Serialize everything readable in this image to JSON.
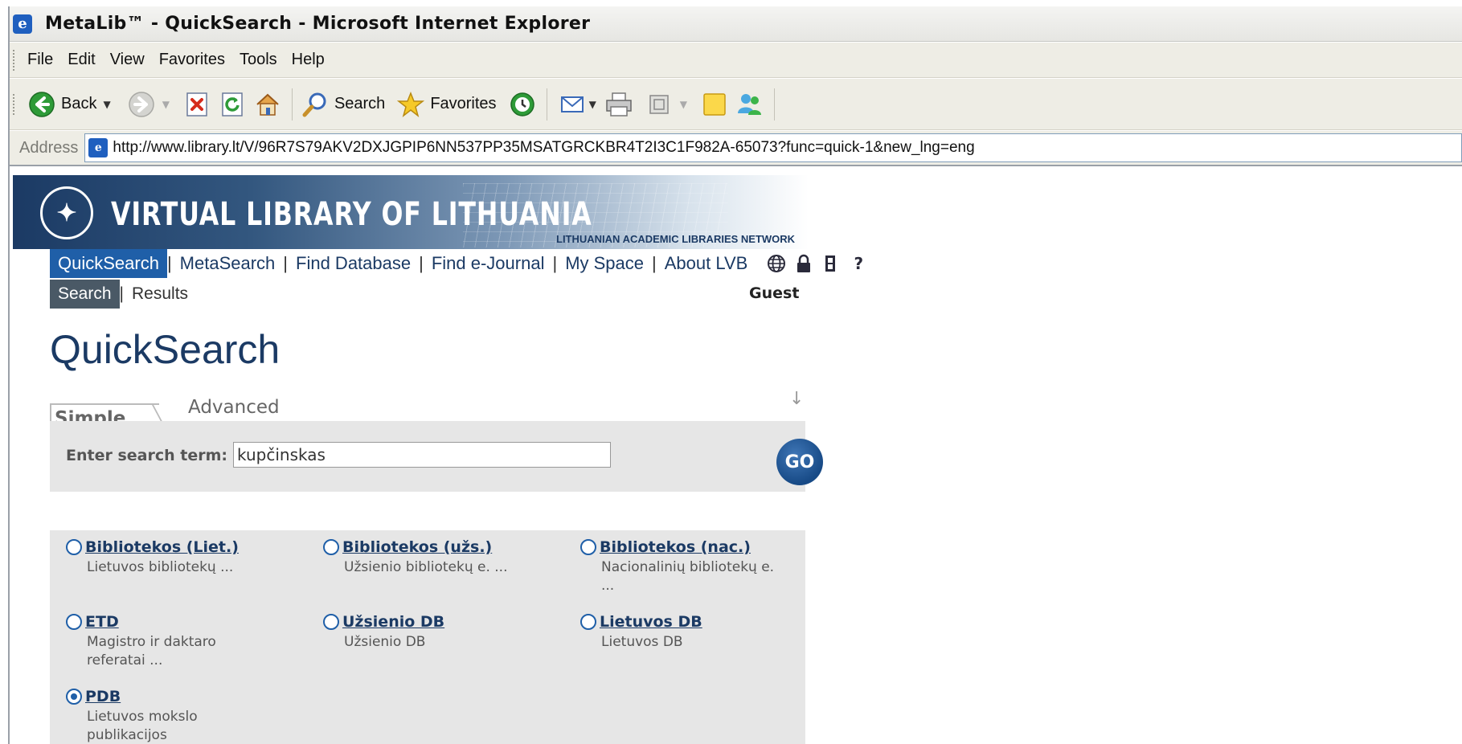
{
  "window": {
    "title": "MetaLib™ - QuickSearch - Microsoft Internet Explorer",
    "app_icon": "ie-icon"
  },
  "menubar": {
    "items": [
      "File",
      "Edit",
      "View",
      "Favorites",
      "Tools",
      "Help"
    ]
  },
  "toolbar": {
    "back_label": "Back",
    "search_label": "Search",
    "favorites_label": "Favorites"
  },
  "addressbar": {
    "label": "Address",
    "url": "http://www.library.lt/V/96R7S79AKV2DXJGPIP6NN537PP35MSATGRCKBR4T2I3C1F982A-65073?func=quick-1&new_lng=eng"
  },
  "banner": {
    "brand": "VIRTUAL LIBRARY OF LITHUANIA",
    "network": "LITHUANIAN ACADEMIC LIBRARIES NETWORK"
  },
  "nav": {
    "items": [
      "QuickSearch",
      "MetaSearch",
      "Find Database",
      "Find e-Journal",
      "My Space",
      "About LVB"
    ],
    "active": "QuickSearch"
  },
  "subnav": {
    "search": "Search",
    "results": "Results"
  },
  "user": "Guest",
  "page_title": "QuickSearch",
  "tabs": {
    "simple": "Simple",
    "advanced": "Advanced"
  },
  "search": {
    "label": "Enter search term:",
    "value": "kupčinskas",
    "go": "GO"
  },
  "databases": [
    {
      "name": "Bibliotekos (Liet.)",
      "desc": "Lietuvos bibliotekų ...",
      "checked": false
    },
    {
      "name": "Bibliotekos (užs.)",
      "desc": "Užsienio bibliotekų e. ...",
      "checked": false
    },
    {
      "name": "Bibliotekos (nac.)",
      "desc": "Nacionalinių bibliotekų e. ...",
      "checked": false
    },
    {
      "name": "ETD",
      "desc": "Magistro ir daktaro referatai ...",
      "checked": false
    },
    {
      "name": "Užsienio DB",
      "desc": "Užsienio DB",
      "checked": false
    },
    {
      "name": "Lietuvos DB",
      "desc": "Lietuvos DB",
      "checked": false
    },
    {
      "name": "PDB",
      "desc": "Lietuvos mokslo publikacijos",
      "checked": true
    }
  ]
}
